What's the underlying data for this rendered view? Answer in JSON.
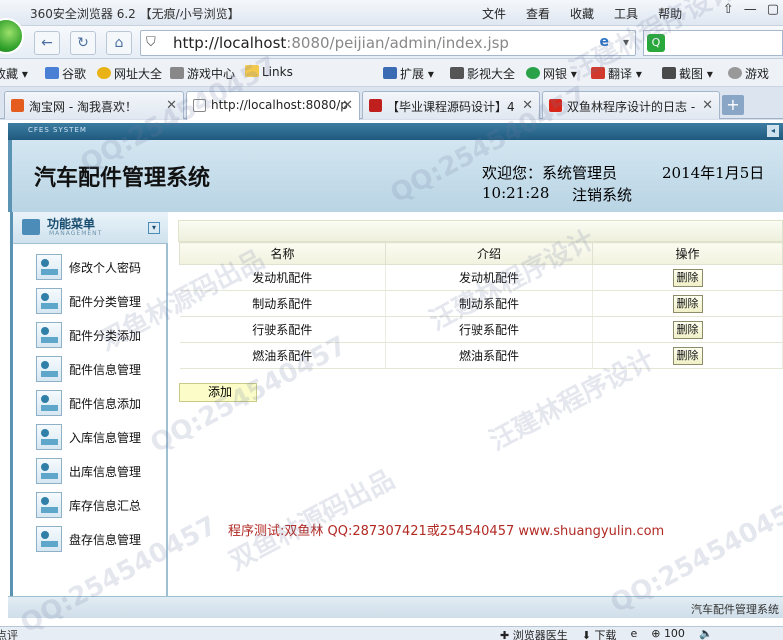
{
  "browser": {
    "title": "360安全浏览器 6.2 【无痕/小号浏览】",
    "menu": [
      "文件",
      "查看",
      "收藏",
      "工具",
      "帮助"
    ],
    "address": {
      "host": "http://localhost",
      "rest": ":8080/peijian/admin/index.jsp"
    },
    "favorites": [
      "收藏",
      "谷歌",
      "网址大全",
      "游戏中心",
      "Links",
      "扩展",
      "影视大全",
      "网银",
      "翻译",
      "截图",
      "游戏"
    ],
    "tabs": [
      {
        "label": "淘宝网 - 淘我喜欢！",
        "color": "#e55c1f"
      },
      {
        "label": "http://localhost:8080/p",
        "color": "#ffffff",
        "active": true
      },
      {
        "label": "【毕业课程源码设计】4",
        "color": "#c0201d"
      },
      {
        "label": "双鱼林程序设计的日志 -",
        "color": "#d8261a"
      }
    ]
  },
  "app": {
    "band_label": "CFES SYSTEM",
    "title": "汽车配件管理系统",
    "welcome": "欢迎您：系统管理员",
    "date": "2014年1月5日",
    "time": "10:21:28",
    "logout": "注销系统",
    "footer": "汽车配件管理系统"
  },
  "sidebar": {
    "title": "功能菜单",
    "subtitle": "MANAGEMENT",
    "items": [
      "修改个人密码",
      "配件分类管理",
      "配件分类添加",
      "配件信息管理",
      "配件信息添加",
      "入库信息管理",
      "出库信息管理",
      "库存信息汇总",
      "盘存信息管理"
    ]
  },
  "table": {
    "headers": [
      "名称",
      "介绍",
      "操作"
    ],
    "rows": [
      [
        "发动机配件",
        "发动机配件",
        "删除"
      ],
      [
        "制动系配件",
        "制动系配件",
        "删除"
      ],
      [
        "行驶系配件",
        "行驶系配件",
        "删除"
      ],
      [
        "燃油系配件",
        "燃油系配件",
        "删除"
      ]
    ],
    "add_label": "添加"
  },
  "credit": "程序测试:双鱼林 QQ:287307421或254540457 www.shuangyulin.com",
  "statusbar": {
    "left": "点评",
    "right": [
      "浏览器医生",
      "下载",
      "100"
    ]
  },
  "watermarks": [
    "汪建林程序设计",
    "QQ:254540457",
    "双鱼林源码出品",
    "QQ:254540457",
    "汪建林程序设计",
    "双鱼林源码出品",
    "QQ:254540457",
    "QQ:254540457",
    "汪建林程序设计"
  ]
}
